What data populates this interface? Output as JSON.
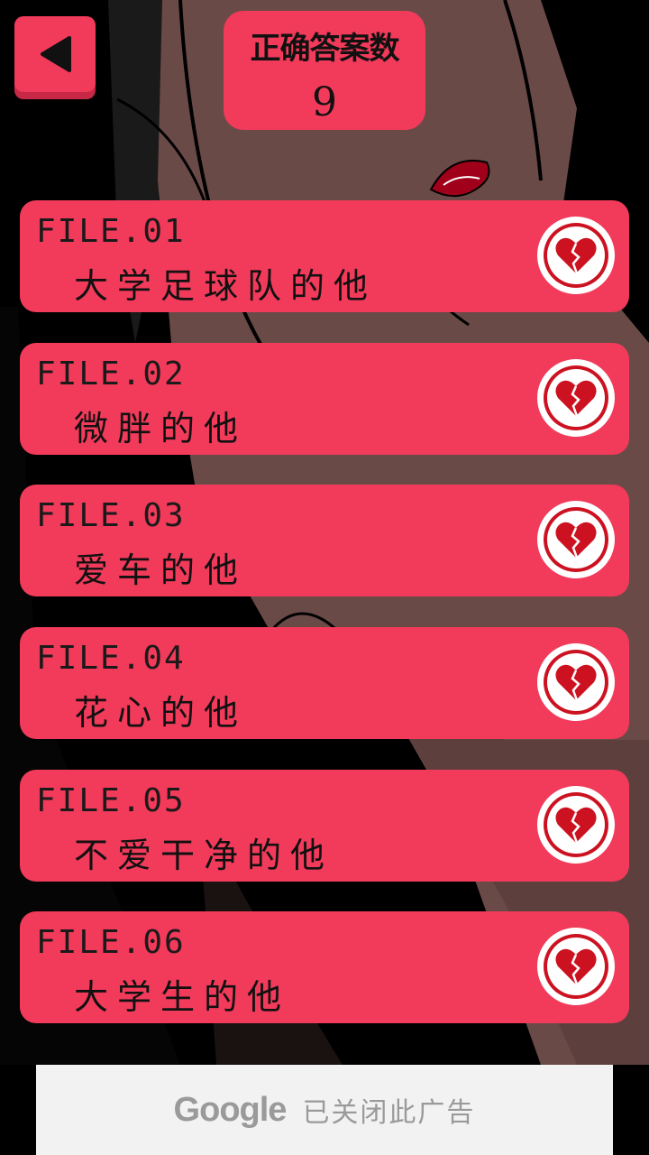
{
  "header": {
    "back_icon": "back-arrow-icon",
    "score_label": "正确答案数",
    "score_value": "9"
  },
  "files": [
    {
      "code": "FILE.01",
      "title": "大学足球队的他",
      "status_icon": "broken-heart-icon"
    },
    {
      "code": "FILE.02",
      "title": "微胖的他",
      "status_icon": "broken-heart-icon"
    },
    {
      "code": "FILE.03",
      "title": "爱车的他",
      "status_icon": "broken-heart-icon"
    },
    {
      "code": "FILE.04",
      "title": "花心的他",
      "status_icon": "broken-heart-icon"
    },
    {
      "code": "FILE.05",
      "title": "不爱干净的他",
      "status_icon": "broken-heart-icon"
    },
    {
      "code": "FILE.06",
      "title": "大学生的他",
      "status_icon": "broken-heart-icon"
    }
  ],
  "ad": {
    "brand": "Google",
    "message": "已关闭此广告"
  },
  "colors": {
    "card": "#f23a5a",
    "heart": "#cc1220",
    "background_skin": "#6a4a47"
  }
}
